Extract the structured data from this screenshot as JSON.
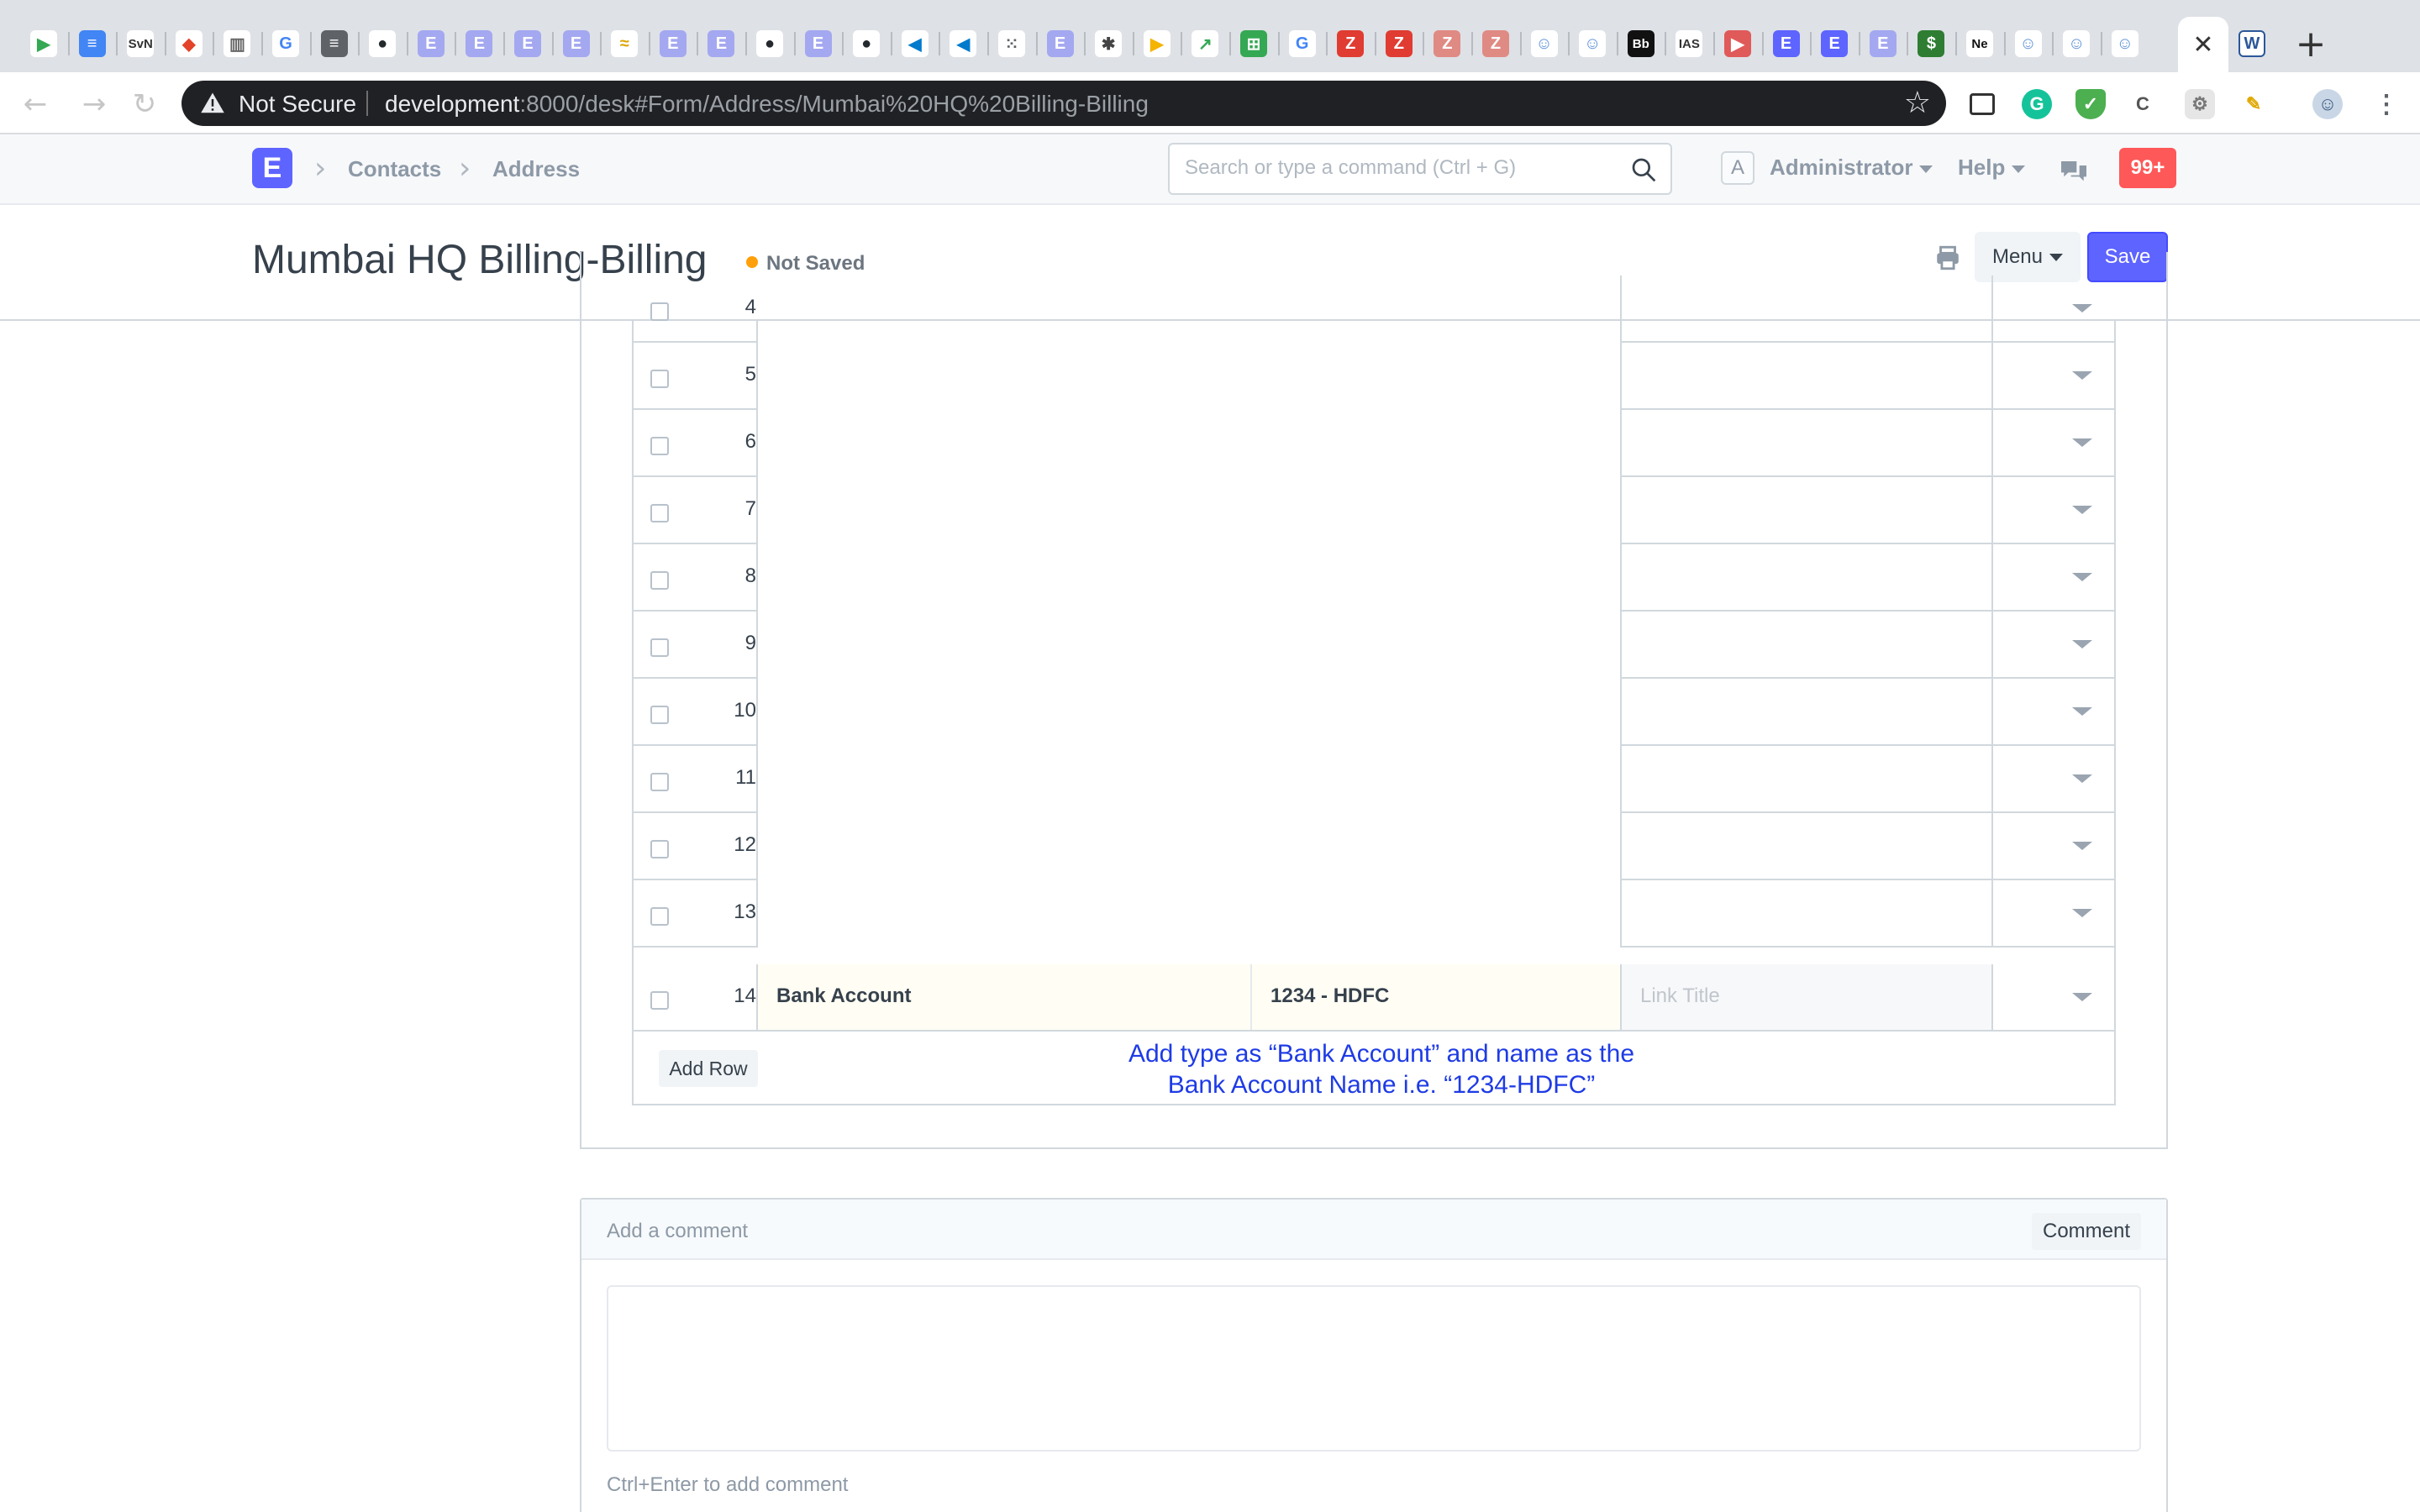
{
  "browser": {
    "tabs": [
      {
        "letter": "▶",
        "color": "#34a853",
        "bg": "#ffffff"
      },
      {
        "letter": "≡",
        "color": "#ffffff",
        "bg": "#4285f4"
      },
      {
        "letter": "SvN",
        "color": "#333333",
        "bg": "#ffffff"
      },
      {
        "letter": "◆",
        "color": "#e24329",
        "bg": "#ffffff"
      },
      {
        "letter": "▥",
        "color": "#666666",
        "bg": "#ffffff"
      },
      {
        "letter": "G",
        "color": "#4285f4",
        "bg": "#ffffff"
      },
      {
        "letter": "≡",
        "color": "#ffffff",
        "bg": "#5f6368"
      },
      {
        "letter": "●",
        "color": "#24292e",
        "bg": "#ffffff"
      },
      {
        "letter": "E",
        "color": "#ffffff",
        "bg": "#a4a8f0"
      },
      {
        "letter": "E",
        "color": "#ffffff",
        "bg": "#a4a8f0"
      },
      {
        "letter": "E",
        "color": "#ffffff",
        "bg": "#a4a8f0"
      },
      {
        "letter": "E",
        "color": "#ffffff",
        "bg": "#a4a8f0"
      },
      {
        "letter": "≈",
        "color": "#d9a400",
        "bg": "#ffffff"
      },
      {
        "letter": "E",
        "color": "#ffffff",
        "bg": "#a4a8f0"
      },
      {
        "letter": "E",
        "color": "#ffffff",
        "bg": "#a4a8f0"
      },
      {
        "letter": "●",
        "color": "#24292e",
        "bg": "#ffffff"
      },
      {
        "letter": "E",
        "color": "#ffffff",
        "bg": "#a4a8f0"
      },
      {
        "letter": "●",
        "color": "#24292e",
        "bg": "#ffffff"
      },
      {
        "letter": "◀",
        "color": "#007acc",
        "bg": "#ffffff"
      },
      {
        "letter": "◀",
        "color": "#007acc",
        "bg": "#ffffff"
      },
      {
        "letter": "⁙",
        "color": "#5f6368",
        "bg": "#ffffff"
      },
      {
        "letter": "E",
        "color": "#ffffff",
        "bg": "#a4a8f0"
      },
      {
        "letter": "✱",
        "color": "#444444",
        "bg": "#ffffff"
      },
      {
        "letter": "▶",
        "color": "#f4b400",
        "bg": "#ffffff"
      },
      {
        "letter": "↗",
        "color": "#34a853",
        "bg": "#ffffff"
      },
      {
        "letter": "⊞",
        "color": "#ffffff",
        "bg": "#34a853"
      },
      {
        "letter": "G",
        "color": "#4285f4",
        "bg": "#ffffff"
      },
      {
        "letter": "Z",
        "color": "#ffffff",
        "bg": "#e03c31"
      },
      {
        "letter": "Z",
        "color": "#ffffff",
        "bg": "#e03c31"
      },
      {
        "letter": "Z",
        "color": "#ffffff",
        "bg": "#e08a84"
      },
      {
        "letter": "Z",
        "color": "#ffffff",
        "bg": "#e08a84"
      },
      {
        "letter": "☺",
        "color": "#5a8fd8",
        "bg": "#ffffff"
      },
      {
        "letter": "☺",
        "color": "#5a8fd8",
        "bg": "#ffffff"
      },
      {
        "letter": "Bb",
        "color": "#ffffff",
        "bg": "#111111"
      },
      {
        "letter": "IAS",
        "color": "#333333",
        "bg": "#ffffff"
      },
      {
        "letter": "▶",
        "color": "#ffffff",
        "bg": "#e05a5a"
      },
      {
        "letter": "E",
        "color": "#ffffff",
        "bg": "#5e64ff"
      },
      {
        "letter": "E",
        "color": "#ffffff",
        "bg": "#5e64ff"
      },
      {
        "letter": "E",
        "color": "#ffffff",
        "bg": "#a4a8f0"
      },
      {
        "letter": "$",
        "color": "#ffffff",
        "bg": "#2e7d32"
      },
      {
        "letter": "Ne",
        "color": "#111111",
        "bg": "#ffffff"
      },
      {
        "letter": "☺",
        "color": "#5a8fd8",
        "bg": "#ffffff"
      },
      {
        "letter": "☺",
        "color": "#5a8fd8",
        "bg": "#ffffff"
      },
      {
        "letter": "☺",
        "color": "#5a8fd8",
        "bg": "#ffffff"
      }
    ],
    "active_tab_close": "✕",
    "last_tab_letter": "W",
    "new_tab": "+",
    "security_label": "Not Secure",
    "url_host": "development",
    "url_rest": ":8000/desk#Form/Address/Mumbai%20HQ%20Billing-Billing",
    "bookmark_icon": "☆",
    "nav_icons": {
      "back": "←",
      "forward": "→",
      "reload": "↻"
    }
  },
  "app": {
    "brand_letter": "E",
    "breadcrumbs": [
      "Contacts",
      "Address"
    ],
    "search_placeholder": "Search or type a command (Ctrl + G)",
    "avatar_letter": "A",
    "user_menu": "Administrator",
    "help_menu": "Help",
    "notification_count": "99+",
    "accent_color": "#5e64ff"
  },
  "page": {
    "title": "Mumbai HQ Billing-Billing",
    "status": "Not Saved",
    "menu_label": "Menu",
    "save_label": "Save"
  },
  "links_table": {
    "rows": [
      {
        "idx": "4"
      },
      {
        "idx": "5"
      },
      {
        "idx": "6"
      },
      {
        "idx": "7"
      },
      {
        "idx": "8"
      },
      {
        "idx": "9"
      },
      {
        "idx": "10"
      },
      {
        "idx": "11"
      },
      {
        "idx": "12"
      },
      {
        "idx": "13"
      }
    ],
    "new_row": {
      "idx": "14",
      "link_doctype": "Bank Account",
      "link_name": "1234 - HDFC",
      "link_title_placeholder": "Link Title"
    },
    "add_row_label": "Add Row",
    "annotation_line1": "Add type as “Bank Account” and name as the",
    "annotation_line2": "Bank Account Name i.e. “1234-HDFC”"
  },
  "comments": {
    "placeholder": "Add a comment",
    "button_label": "Comment",
    "hint": "Ctrl+Enter to add comment"
  }
}
